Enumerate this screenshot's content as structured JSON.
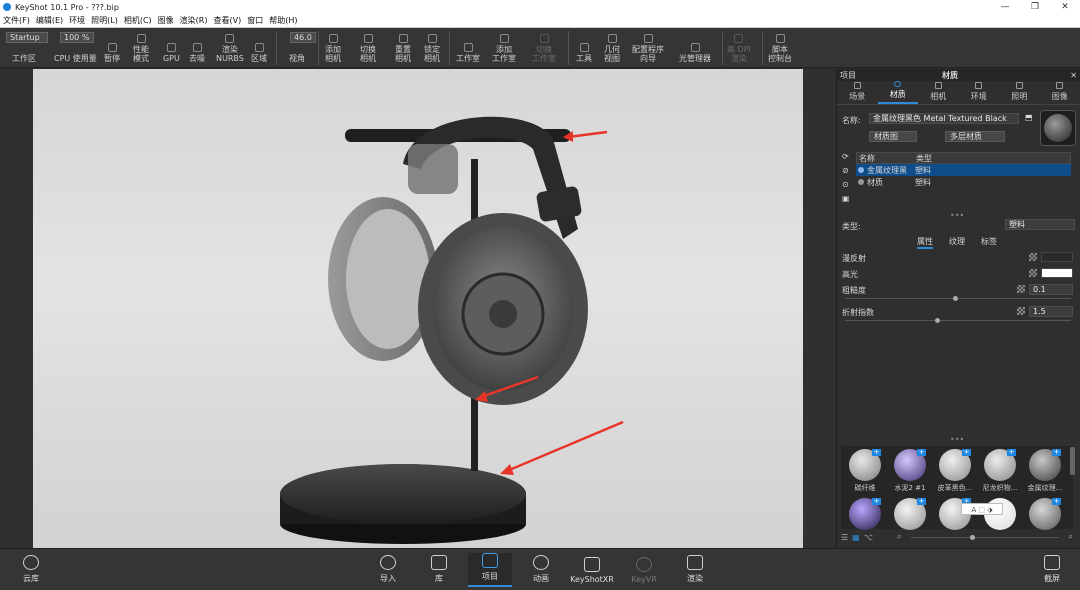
{
  "window": {
    "title": "KeyShot 10.1 Pro  -  ???.bip",
    "controls": [
      "—",
      "❐",
      "✕"
    ]
  },
  "menu": [
    "文件(F)",
    "编辑(E)",
    "环境",
    "照明(L)",
    "相机(C)",
    "图像",
    "渲染(R)",
    "查看(V)",
    "窗口",
    "帮助(H)"
  ],
  "toolbar": {
    "workspace_value": "Startup",
    "zoom_value": "100 %",
    "fov_value": "46.0",
    "items": {
      "workspace": "工作区",
      "cpu": "CPU 使用量",
      "pause": "暂停",
      "perf": "性能\n模式",
      "gpu": "GPU",
      "denoise": "去噪",
      "nurbs": "渲染\nNURBS",
      "region": "区域",
      "fov": "视角",
      "add_camera": "添加\n相机",
      "switch_camera": "切换\n相机",
      "reset_camera": "重置\n相机",
      "lock_camera": "锁定\n相机",
      "studio": "工作室",
      "add_studio": "添加\n工作室",
      "switch_studio": "切换\n工作室",
      "tools": "工具",
      "geometry_view": "几何\n视图",
      "config_wizard": "配置程序\n向导",
      "light_manager": "光管理器",
      "dpi": "高 DPI\n渲染",
      "script": "脚本\n控制台"
    }
  },
  "right_panel": {
    "header_left": "项目",
    "header_center": "材质",
    "tabs": [
      "场景",
      "材质",
      "相机",
      "环境",
      "照明",
      "图像"
    ],
    "active_tab": "材质",
    "name_label": "名称:",
    "name_value": "金属纹理黑色 Metal Textured Black",
    "material_graph_button": "材质图",
    "multi_material_button": "多层材质",
    "table_headers": [
      "名称",
      "类型"
    ],
    "table_rows": [
      {
        "name": "金属纹理黑",
        "type": "塑料",
        "selected": true
      },
      {
        "name": "材质",
        "type": "塑料",
        "selected": false
      }
    ],
    "type_label": "类型:",
    "type_value": "塑料",
    "subtabs": [
      "属性",
      "纹理",
      "标签"
    ],
    "active_subtab": "属性",
    "properties": [
      {
        "label": "漫反射",
        "value": "",
        "slider": null
      },
      {
        "label": "高光",
        "value": "",
        "slider": null
      },
      {
        "label": "粗糙度",
        "value": "0.1",
        "slider": 0.48
      },
      {
        "label": "折射指数",
        "value": "1.5",
        "slider": 0.4
      }
    ],
    "library": {
      "items": [
        "碳纤维",
        "水泥2 #1",
        "皮革黑色...",
        "尼龙织物...",
        "金属纹理..."
      ],
      "popup_icons": "A ⬚ ⬗"
    }
  },
  "bottom_bar": {
    "cloud": "云库",
    "import": "导入",
    "library": "库",
    "project": "项目",
    "animation": "动画",
    "keyshotxr": "KeyShotXR",
    "keyvr": "KeyVR",
    "render": "渲染",
    "screenshot": "截屏"
  },
  "colors": {
    "accent": "#2f8bd8",
    "arrow": "#e8352a",
    "selection": "#0f4d8a"
  }
}
